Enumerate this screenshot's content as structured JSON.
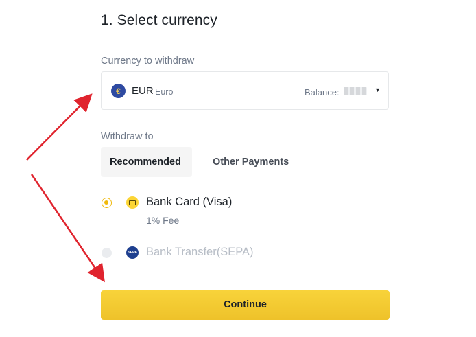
{
  "page": {
    "title": "1. Select currency"
  },
  "currency": {
    "label": "Currency to withdraw",
    "symbol": "€",
    "code": "EUR",
    "name": "Euro",
    "balance_label": "Balance:",
    "caret": "▼"
  },
  "withdraw": {
    "label": "Withdraw to",
    "tabs": [
      {
        "label": "Recommended",
        "active": true
      },
      {
        "label": "Other Payments",
        "active": false
      }
    ],
    "methods": [
      {
        "name": "Bank Card (Visa)",
        "fee": "1% Fee",
        "selected": true,
        "enabled": true,
        "icon": "card-icon"
      },
      {
        "name": "Bank Transfer(SEPA)",
        "icon_text": "SEPA",
        "selected": false,
        "enabled": false,
        "icon": "sepa-icon"
      }
    ]
  },
  "continue_label": "Continue",
  "colors": {
    "accent": "#f0b90b",
    "annotation": "#e0242e"
  }
}
